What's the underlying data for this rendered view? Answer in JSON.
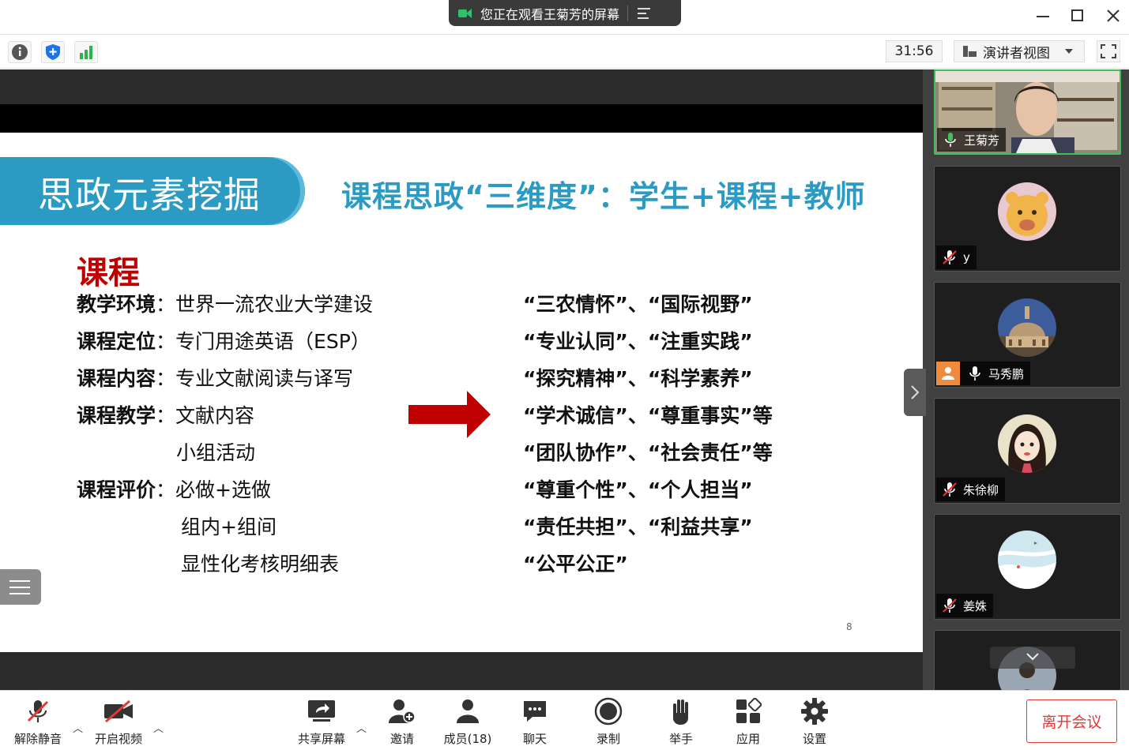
{
  "share_banner": {
    "text": "您正在观看王菊芳的屏幕"
  },
  "toolbar": {
    "timer": "31:56",
    "view_label": "演讲者视图"
  },
  "slide": {
    "ribbon_title": "思政元素挖掘",
    "title": "课程思政“三维度”：学生+课程+教师",
    "heading": "课程",
    "left_rows": [
      {
        "label": "教学环境",
        "colon": "：",
        "value": "世界一流农业大学建设"
      },
      {
        "label": "课程定位",
        "colon": "：",
        "value": "专门用途英语（ESP）"
      },
      {
        "label": "课程内容",
        "colon": "：",
        "value": "专业文献阅读与译写"
      },
      {
        "label": "课程教学",
        "colon": "：",
        "value": "文献内容"
      },
      {
        "label": "",
        "colon": "",
        "value": "小组活动"
      },
      {
        "label": "课程评价",
        "colon": "：",
        "value": "必做+选做"
      },
      {
        "label": "",
        "colon": "",
        "value": "组内+组间"
      },
      {
        "label": "",
        "colon": "",
        "value": "显性化考核明细表"
      }
    ],
    "right_rows": [
      "“三农情怀”、“国际视野”",
      "“专业认同”、“注重实践”",
      "“探究精神”、“科学素养”",
      "“学术诚信”、“尊重事实”等",
      "“团队协作”、“社会责任”等",
      "“尊重个性”、“个人担当”",
      "“责任共担”、“利益共享”",
      "“公平公正”"
    ],
    "page_number": "8"
  },
  "participants": [
    {
      "name": "王菊芳",
      "muted": false,
      "speaking": true
    },
    {
      "name": "y",
      "muted": true
    },
    {
      "name": "马秀鹏",
      "muted": false,
      "host": true
    },
    {
      "name": "朱徐柳",
      "muted": true
    },
    {
      "name": "姜姝",
      "muted": true
    }
  ],
  "bottom": {
    "unmute": "解除静音",
    "video": "开启视频",
    "share": "共享屏幕",
    "invite": "邀请",
    "members": "成员(18)",
    "chat": "聊天",
    "record": "录制",
    "raise_hand": "举手",
    "apps": "应用",
    "settings": "设置",
    "leave": "离开会议"
  },
  "colors": {
    "accent_blue": "#2b9bc4",
    "heading_red": "#c00000",
    "arrow_red": "#c00000",
    "speaking_green": "#3fbf5f",
    "leave_red": "#e53935"
  }
}
